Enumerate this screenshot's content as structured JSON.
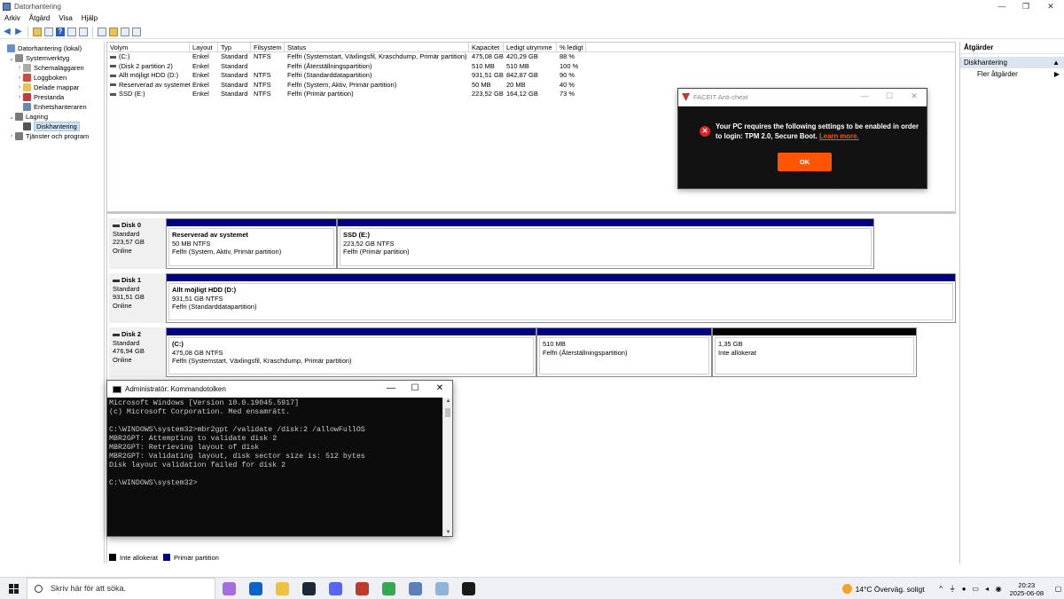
{
  "window": {
    "title": "Datorhantering",
    "min": "—",
    "restore": "❐",
    "close": "✕"
  },
  "menu": [
    "Arkiv",
    "Åtgärd",
    "Visa",
    "Hjälp"
  ],
  "tree": [
    {
      "label": "Datorhantering (lokal)",
      "indent": 0,
      "exp": "",
      "icon": "computer-management-icon",
      "color": "#6a8cc7"
    },
    {
      "label": "Systemverktyg",
      "indent": 1,
      "exp": "v",
      "icon": "tools-icon",
      "color": "#8a8a8a"
    },
    {
      "label": "Schemaläggaren",
      "indent": 2,
      "exp": ">",
      "icon": "clock-icon",
      "color": "#aaaaaa"
    },
    {
      "label": "Loggboken",
      "indent": 2,
      "exp": ">",
      "icon": "event-viewer-icon",
      "color": "#d14b3c"
    },
    {
      "label": "Delade mappar",
      "indent": 2,
      "exp": ">",
      "icon": "shared-folder-icon",
      "color": "#e8c25a"
    },
    {
      "label": "Prestanda",
      "indent": 2,
      "exp": ">",
      "icon": "performance-icon",
      "color": "#c43b3b"
    },
    {
      "label": "Enhetshanteraren",
      "indent": 2,
      "exp": "",
      "icon": "device-manager-icon",
      "color": "#6d87ad"
    },
    {
      "label": "Lagring",
      "indent": 1,
      "exp": "v",
      "icon": "storage-icon",
      "color": "#7a7a7a"
    },
    {
      "label": "Diskhantering",
      "indent": 2,
      "exp": "",
      "icon": "disk-management-icon",
      "color": "#555555",
      "selected": true
    },
    {
      "label": "Tjänster och program",
      "indent": 1,
      "exp": ">",
      "icon": "services-icon",
      "color": "#7a7a7a"
    }
  ],
  "volumes": {
    "headers": [
      "Volym",
      "Layout",
      "Typ",
      "Filsystem",
      "Status",
      "Kapacitet",
      "Ledigt utrymme",
      "% ledigt"
    ],
    "rows": [
      [
        "(C:)",
        "Enkel",
        "Standard",
        "NTFS",
        "Felfri (Systemstart, Växlingsfil, Kraschdump, Primär partition)",
        "475,08 GB",
        "420,29 GB",
        "88 %"
      ],
      [
        "(Disk 2 partition 2)",
        "Enkel",
        "Standard",
        "",
        "Felfri (Återställningspartition)",
        "510 MB",
        "510 MB",
        "100 %"
      ],
      [
        "Allt möjligt HDD (D:)",
        "Enkel",
        "Standard",
        "NTFS",
        "Felfri (Standarddatapartition)",
        "931,51 GB",
        "842,87 GB",
        "90 %"
      ],
      [
        "Reserverad av systemet",
        "Enkel",
        "Standard",
        "NTFS",
        "Felfri (System, Aktiv, Primär partition)",
        "50 MB",
        "20 MB",
        "40 %"
      ],
      [
        "SSD (E:)",
        "Enkel",
        "Standard",
        "NTFS",
        "Felfri (Primär partition)",
        "223,52 GB",
        "164,12 GB",
        "73 %"
      ]
    ]
  },
  "disks": [
    {
      "name": "Disk 0",
      "type": "Standard",
      "size": "223,57 GB",
      "status": "Online",
      "parts": [
        {
          "name": "Reserverad av systemet",
          "size": "50 MB NTFS",
          "status": "Felfri (System, Aktiv, Primär partition)"
        },
        {
          "name": "SSD  (E:)",
          "size": "223,52 GB NTFS",
          "status": "Felfri (Primär partition)"
        }
      ]
    },
    {
      "name": "Disk 1",
      "type": "Standard",
      "size": "931,51 GB",
      "status": "Online",
      "parts": [
        {
          "name": "Allt möjligt HDD  (D:)",
          "size": "931,51 GB NTFS",
          "status": "Felfri (Standarddatapartition)"
        }
      ]
    },
    {
      "name": "Disk 2",
      "type": "Standard",
      "size": "476,94 GB",
      "status": "Online",
      "parts": [
        {
          "name": "(C:)",
          "size": "475,08 GB NTFS",
          "status": "Felfri (Systemstart, Växlingsfil, Kraschdump, Primär partition)"
        },
        {
          "name": "",
          "size": "510 MB",
          "status": "Felfri (Återställningspartition)"
        },
        {
          "name": "",
          "size": "1,35 GB",
          "status": "Inte allokerat"
        }
      ]
    }
  ],
  "legend": {
    "unallocated": "Inte allokerat",
    "primary": "Primär partition",
    "colors": {
      "unallocated": "#000000",
      "primary": "#000080"
    }
  },
  "actions": {
    "header": "Åtgärder",
    "section": "Diskhantering",
    "item": "Fler åtgärder"
  },
  "faceit": {
    "title": "FACEIT Anti-cheat",
    "message": "Your PC requires the following settings to be enabled in order to login: TPM 2.0, Secure Boot.",
    "link": "Learn more.",
    "ok": "OK",
    "accent": "#ff5500"
  },
  "cmd": {
    "title": "Administratör: Kommandotolken",
    "lines": [
      "Microsoft Windows [Version 10.0.19045.5917]",
      "(c) Microsoft Corporation. Med ensamrätt.",
      "",
      "C:\\WINDOWS\\system32>mbr2gpt /validate /disk:2 /allowFullOS",
      "MBR2GPT: Attempting to validate disk 2",
      "MBR2GPT: Retrieving layout of disk",
      "MBR2GPT: Validating layout, disk sector size is: 512 bytes",
      "Disk layout validation failed for disk 2",
      "",
      "C:\\WINDOWS\\system32>"
    ]
  },
  "taskbar": {
    "search_placeholder": "Skriv här för att söka.",
    "apps": [
      {
        "name": "copilot-icon",
        "color": "#a46de0"
      },
      {
        "name": "outlook-icon",
        "color": "#0a64c8"
      },
      {
        "name": "file-explorer-icon",
        "color": "#f0c040"
      },
      {
        "name": "steam-icon",
        "color": "#1b2838"
      },
      {
        "name": "discord-icon",
        "color": "#5865f2"
      },
      {
        "name": "faceit-icon",
        "color": "#c0392b"
      },
      {
        "name": "chrome-icon",
        "color": "#34a853"
      },
      {
        "name": "computer-management-icon",
        "color": "#5b7fb8"
      },
      {
        "name": "disk-tool-icon",
        "color": "#8fb3d9"
      },
      {
        "name": "command-prompt-icon",
        "color": "#1a1a1a"
      }
    ],
    "weather": "14°C  Överväg. soligt",
    "time": "20:23",
    "date": "2025-06-08"
  }
}
